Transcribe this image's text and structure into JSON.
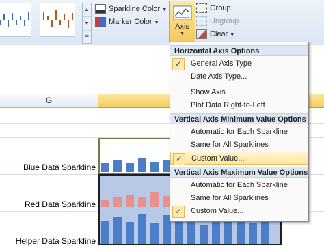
{
  "ribbon": {
    "sparkline_color_label": "Sparkline Color",
    "marker_color_label": "Marker Color",
    "axis_label": "Axis",
    "group_label": "Group",
    "ungroup_label": "Ungroup",
    "clear_label": "Clear",
    "accent_color": "#f8c75a"
  },
  "sheet": {
    "column_g": "G",
    "rows": [
      {
        "label": "Blue Data Sparkline"
      },
      {
        "label": "Red Data Sparkline"
      },
      {
        "label": "Helper Data Sparkline"
      }
    ],
    "colors": {
      "blue": "#4a7ec9",
      "red": "#e8908d",
      "selection": "#b8c9e8"
    }
  },
  "menu": {
    "horizontal_header": "Horizontal Axis Options",
    "general_axis": "General Axis Type",
    "date_axis": "Date Axis Type...",
    "show_axis": "Show Axis",
    "plot_rtl": "Plot Data Right-to-Left",
    "vmin_header": "Vertical Axis Minimum Value Options",
    "vmin_auto": "Automatic for Each Sparkline",
    "vmin_same": "Same for All Sparklines",
    "vmin_custom": "Custom Value...",
    "vmax_header": "Vertical Axis Maximum Value Options",
    "vmax_auto": "Automatic for Each Sparkline",
    "vmax_same": "Same for All Sparklines",
    "vmax_custom": "Custom Value...",
    "check_glyph": "✓"
  }
}
